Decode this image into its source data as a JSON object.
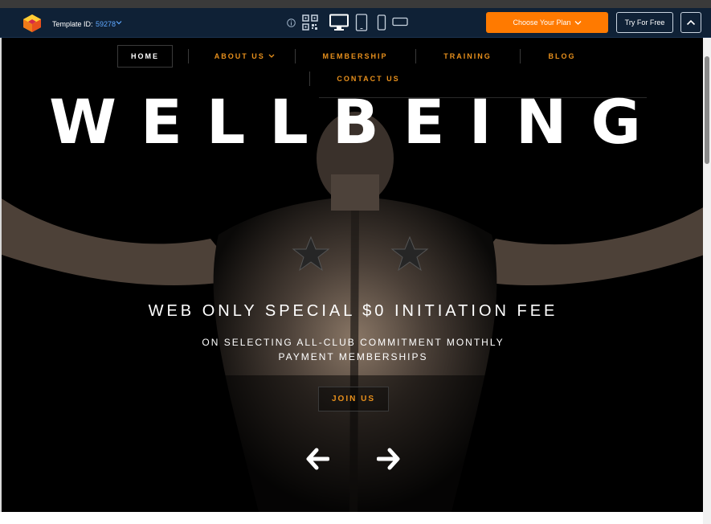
{
  "toolbar": {
    "template_label": "Template ID:",
    "template_id": "59278",
    "plan_button": "Choose Your Plan",
    "try_button": "Try For Free",
    "colors": {
      "bar": "#0f2136",
      "accent": "#ff7a00",
      "link": "#5fa8ff"
    },
    "icons": [
      "logo-icon",
      "info-icon",
      "qr-code-icon",
      "desktop-icon",
      "tablet-icon",
      "mobile-icon",
      "mobile-landscape-icon",
      "chevron-up-icon"
    ]
  },
  "nav": {
    "home": "HOME",
    "about": "ABOUT US",
    "membership": "MEMBERSHIP",
    "training": "TRAINING",
    "blog": "BLOG",
    "contact": "CONTACT US",
    "accent": "#e8901c"
  },
  "hero": {
    "title": "WELLBEING",
    "offer": "WEB ONLY SPECIAL $0 INITIATION FEE",
    "sub_line1": "ON SELECTING ALL-CLUB COMMITMENT MONTHLY",
    "sub_line2": "PAYMENT MEMBERSHIPS",
    "cta": "JOIN US",
    "prev_icon": "arrow-left-icon",
    "next_icon": "arrow-right-icon"
  }
}
